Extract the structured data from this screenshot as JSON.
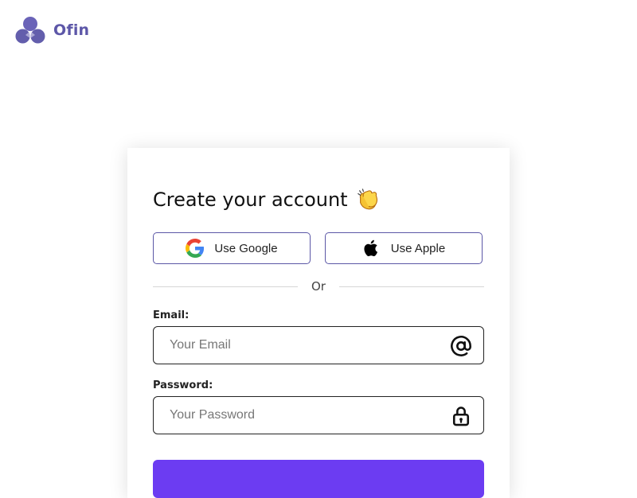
{
  "brand": {
    "name": "Ofin",
    "color": "#5d57a8"
  },
  "form": {
    "title": "Create your account",
    "title_emoji_icon": "clapping-hands-icon",
    "google_label": "Use Google",
    "apple_label": "Use Apple",
    "divider_text": "Or",
    "email": {
      "label": "Email:",
      "placeholder": "Your Email",
      "value": "",
      "icon": "at-sign-icon"
    },
    "password": {
      "label": "Password:",
      "placeholder": "Your Password",
      "value": "",
      "icon": "lock-icon"
    },
    "submit_label": "",
    "submit_color": "#6c3cf2"
  }
}
